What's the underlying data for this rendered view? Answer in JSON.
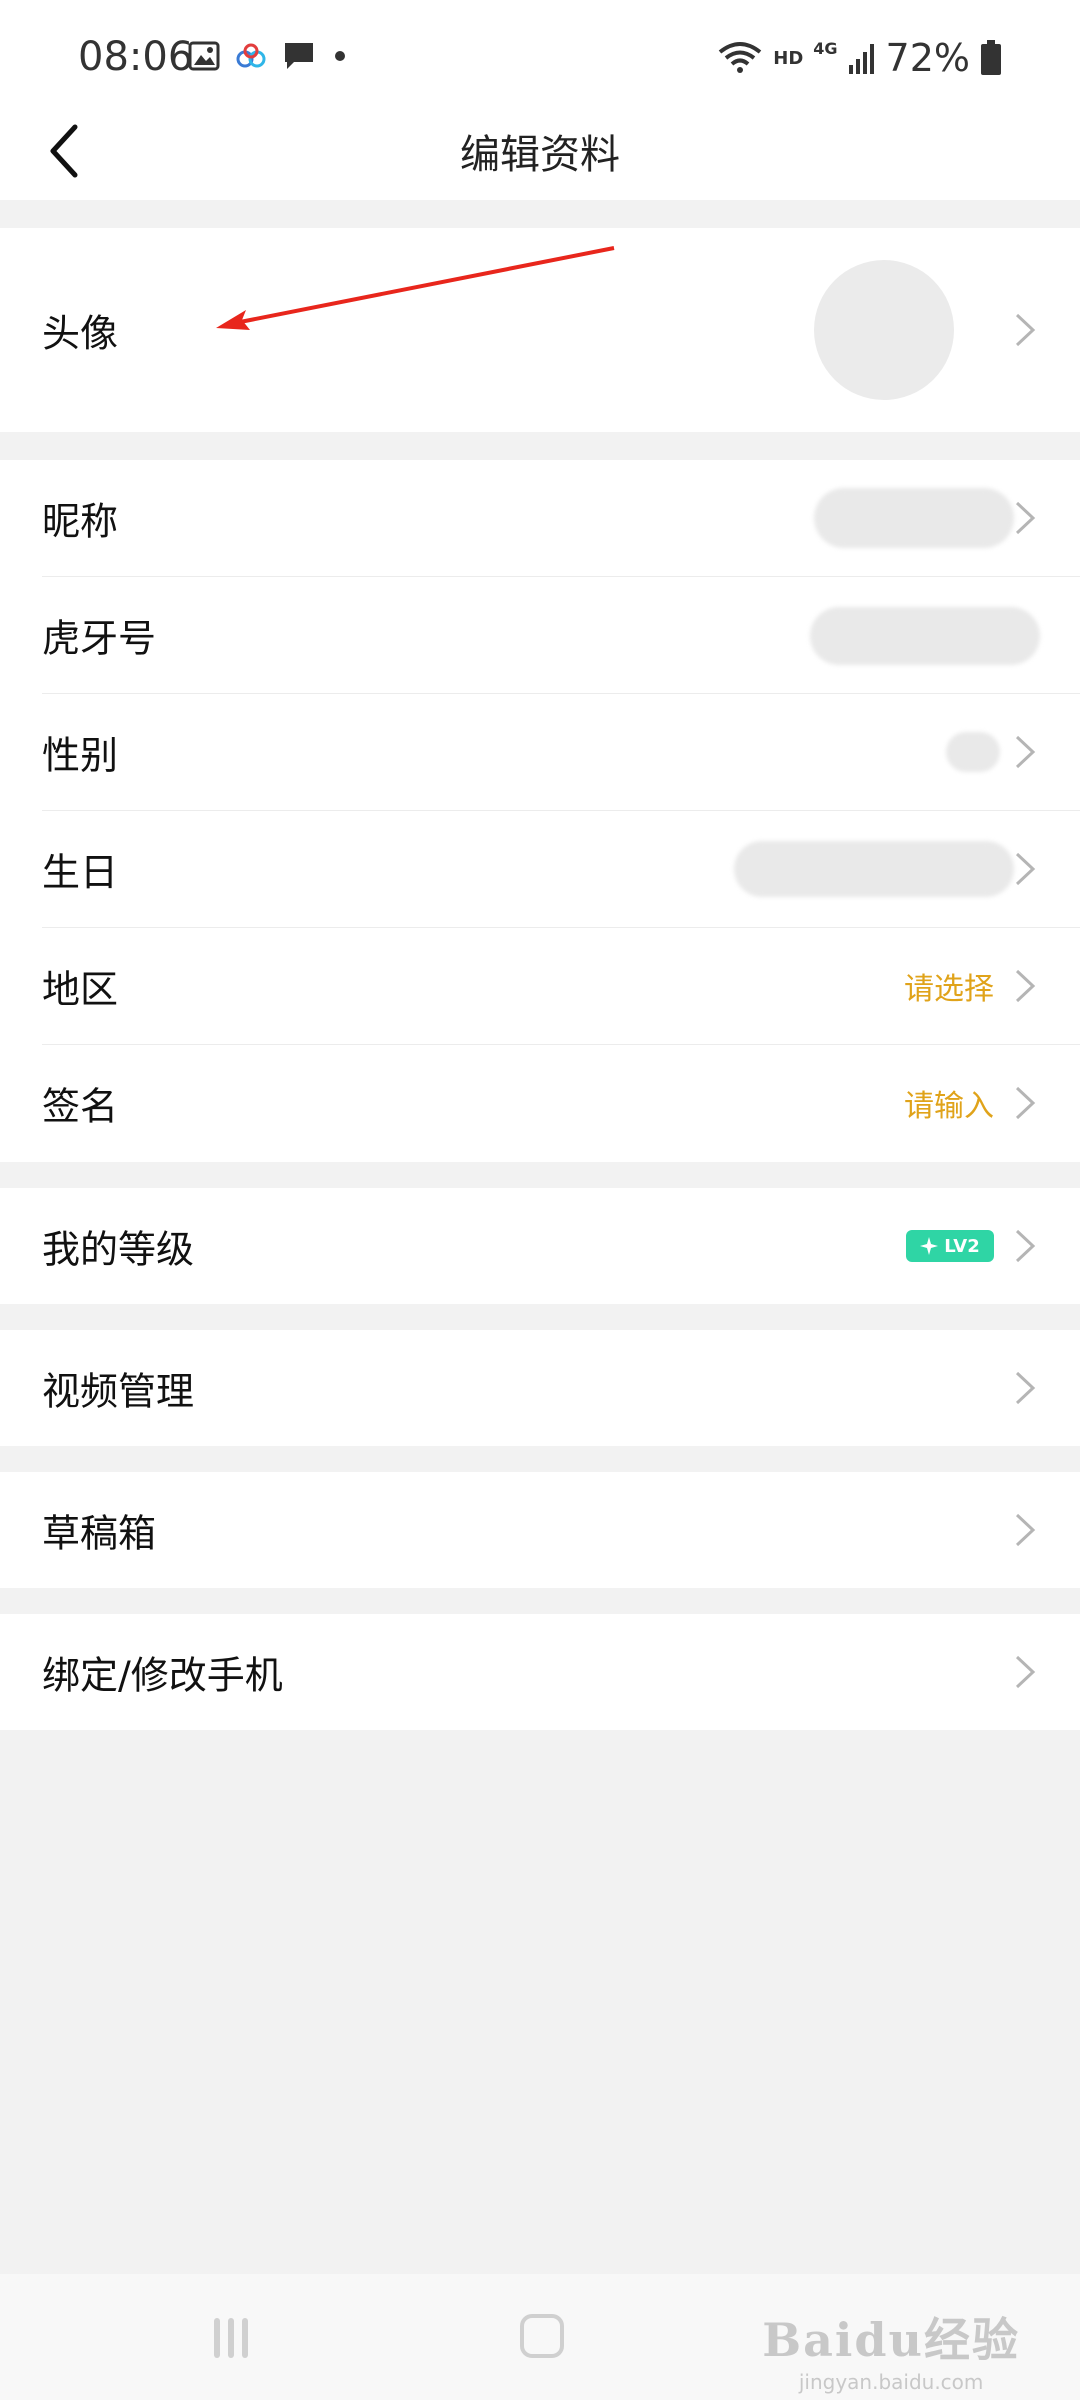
{
  "status_bar": {
    "time": "08:06",
    "network_hd": "HD",
    "network_gen": "4G",
    "battery": "72%"
  },
  "header": {
    "title": "编辑资料"
  },
  "profile": {
    "avatar_label": "头像",
    "nickname_label": "昵称",
    "huya_id_label": "虎牙号",
    "gender_label": "性别",
    "birthday_label": "生日",
    "region_label": "地区",
    "region_value": "请选择",
    "signature_label": "签名",
    "signature_value": "请输入"
  },
  "level": {
    "label": "我的等级",
    "badge": "LV2"
  },
  "menu": {
    "video_manage": "视频管理",
    "drafts": "草稿箱",
    "bind_phone": "绑定/修改手机"
  },
  "watermark": {
    "main": "Baidu经验",
    "sub": "jingyan.baidu.com"
  },
  "colors": {
    "accent_value": "#e0a31a",
    "level_badge": "#2fd5a5",
    "annotation_arrow": "#e8261c"
  }
}
